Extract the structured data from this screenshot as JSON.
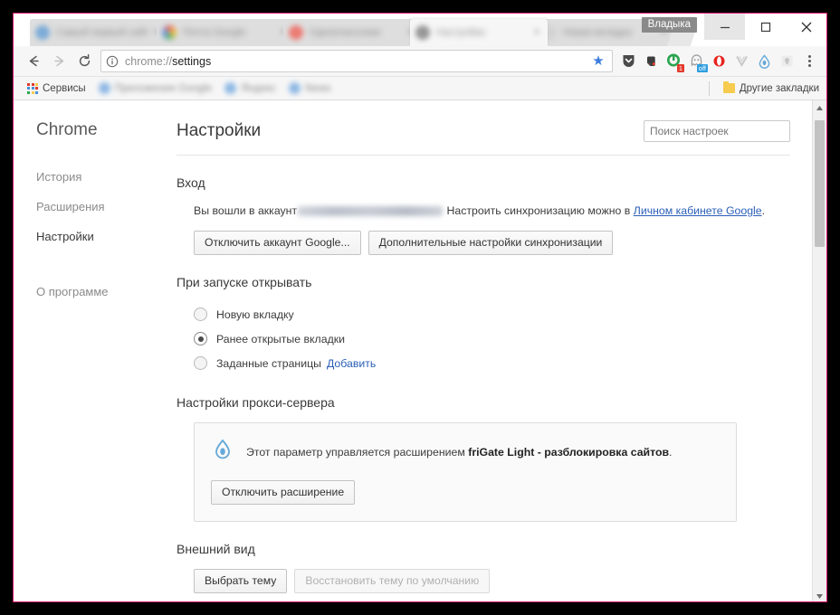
{
  "window": {
    "profile_chip": "Владыка",
    "minimize": "–",
    "maximize": "□",
    "close": "✕"
  },
  "tabs": [
    {
      "title": "Самый первый сайт",
      "active": false
    },
    {
      "title": "Почта Google",
      "active": false
    },
    {
      "title": "Одноклассники",
      "active": false
    },
    {
      "title": "Настройки",
      "active": true
    },
    {
      "title": "Новая вкладка",
      "active": false
    }
  ],
  "toolbar": {
    "back": "←",
    "forward": "→",
    "reload": "⟳",
    "url_scheme": "chrome://",
    "url_path": "settings",
    "bookmark_star": "★",
    "menu": "⋮",
    "extensions": [
      {
        "name": "shield-extension-icon",
        "badge": ""
      },
      {
        "name": "evernote-extension-icon",
        "badge": ""
      },
      {
        "name": "adguard-extension-icon",
        "badge": "1"
      },
      {
        "name": "ghostery-extension-icon",
        "badge": "off"
      },
      {
        "name": "opera-vpn-extension-icon",
        "badge": ""
      },
      {
        "name": "vivaldi-extension-icon",
        "badge": ""
      },
      {
        "name": "frigate-extension-icon",
        "badge": ""
      },
      {
        "name": "lightbulb-extension-icon",
        "badge": ""
      }
    ]
  },
  "bookmarks_bar": {
    "items": [
      {
        "label": "Сервисы",
        "icon": "apps-grid-icon",
        "blurred": false
      },
      {
        "label": "Приложения Google",
        "icon": "bookmark-icon",
        "blurred": true
      },
      {
        "label": "Яндекс",
        "icon": "bookmark-icon",
        "blurred": true
      },
      {
        "label": "News",
        "icon": "bookmark-icon",
        "blurred": true
      }
    ],
    "other_bookmarks": "Другие закладки"
  },
  "sidebar": {
    "brand": "Chrome",
    "items": [
      {
        "label": "История",
        "active": false
      },
      {
        "label": "Расширения",
        "active": false
      },
      {
        "label": "Настройки",
        "active": true
      }
    ],
    "about": {
      "label": "О программе",
      "active": false
    }
  },
  "main": {
    "title": "Настройки",
    "search_placeholder": "Поиск настроек",
    "search_value": "",
    "signin": {
      "heading": "Вход",
      "text_before": "Вы вошли в аккаунт",
      "account_redacted": "",
      "text_after": "Настроить синхронизацию можно в",
      "link": "Личном кабинете Google",
      "period": ".",
      "disconnect_button": "Отключить аккаунт Google...",
      "advanced_button": "Дополнительные настройки синхронизации"
    },
    "startup": {
      "heading": "При запуске открывать",
      "options": [
        {
          "label": "Новую вкладку",
          "selected": false,
          "link": ""
        },
        {
          "label": "Ранее открытые вкладки",
          "selected": true,
          "link": ""
        },
        {
          "label": "Заданные страницы",
          "selected": false,
          "link": "Добавить"
        }
      ]
    },
    "proxy": {
      "heading": "Настройки прокси-сервера",
      "notice_prefix": "Этот параметр управляется расширением",
      "notice_extension": "friGate Light - разблокировка сайтов",
      "notice_suffix": ".",
      "icon": "frigate-logo-icon",
      "disable_button": "Отключить расширение"
    },
    "appearance": {
      "heading": "Внешний вид",
      "choose_theme_button": "Выбрать тему",
      "reset_theme_button": "Восстановить тему по умолчанию",
      "reset_disabled": true
    }
  },
  "scrollbar": {
    "up": "▲",
    "down": "▼"
  },
  "colors": {
    "frame_border": "#d6186e",
    "accent_link": "#2b5fb8",
    "active_nav_bar": "#4b5361",
    "badge_red": "#e23b2e",
    "badge_blue": "#2f9fe0"
  }
}
